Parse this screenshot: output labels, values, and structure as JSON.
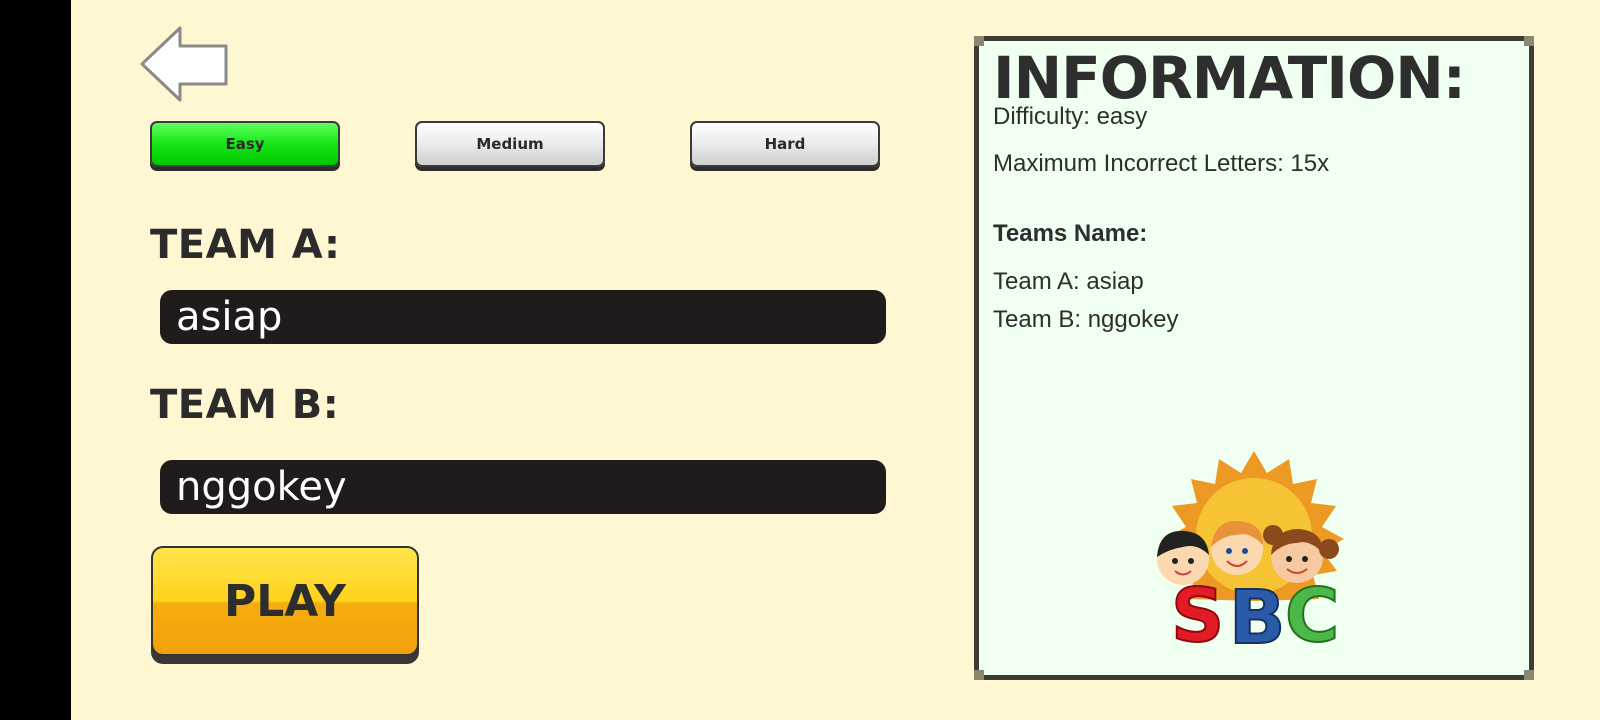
{
  "navigation": {
    "back_icon": "arrow-left-icon"
  },
  "difficulty": {
    "options": [
      {
        "label": "Easy",
        "selected": true
      },
      {
        "label": "Medium",
        "selected": false
      },
      {
        "label": "Hard",
        "selected": false
      }
    ],
    "selected_color": "#00d800"
  },
  "teams": {
    "a": {
      "label": "TEAM A:",
      "value": "asiap"
    },
    "b": {
      "label": "TEAM B:",
      "value": "nggokey"
    }
  },
  "play": {
    "label": "PLAY",
    "color": "#fbc116"
  },
  "info": {
    "title": "INFORMATION:",
    "difficulty_line": "Difficulty: easy",
    "max_incorrect_line": "Maximum Incorrect Letters: 15x",
    "teams_heading": "Teams Name:",
    "team_a_line": "Team A: asiap",
    "team_b_line": "Team B: nggokey",
    "logo_text": "SBC"
  }
}
